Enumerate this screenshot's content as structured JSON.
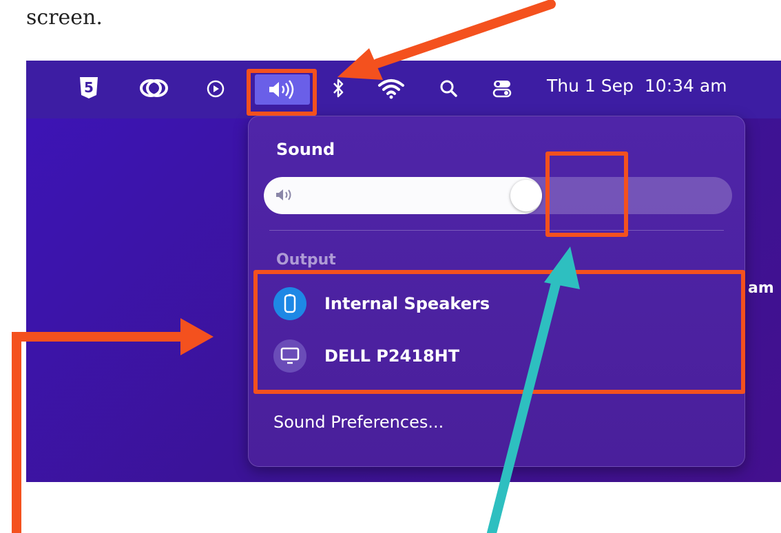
{
  "caption": {
    "text": "screen."
  },
  "menubar": {
    "items": [
      {
        "name": "html5-icon"
      },
      {
        "name": "creative-cloud-icon"
      },
      {
        "name": "play-icon"
      },
      {
        "name": "volume-icon"
      },
      {
        "name": "bluetooth-icon"
      },
      {
        "name": "wifi-icon"
      },
      {
        "name": "search-icon"
      },
      {
        "name": "control-center-icon"
      }
    ],
    "date": "Thu 1 Sep",
    "time": "10:34 am",
    "partial_text": "am"
  },
  "sound_panel": {
    "title": "Sound",
    "volume_level": 0.56,
    "section_output": "Output",
    "devices": [
      {
        "label": "Internal Speakers",
        "icon": "speaker-icon",
        "selected": true
      },
      {
        "label": "DELL P2418HT",
        "icon": "display-icon",
        "selected": false
      }
    ],
    "preferences_label": "Sound Preferences..."
  },
  "colors": {
    "accent_highlight": "#f4511e",
    "accent_teal": "#2ebfc0",
    "selected_device": "#1e88e5",
    "desktop": "#3d14b8"
  }
}
